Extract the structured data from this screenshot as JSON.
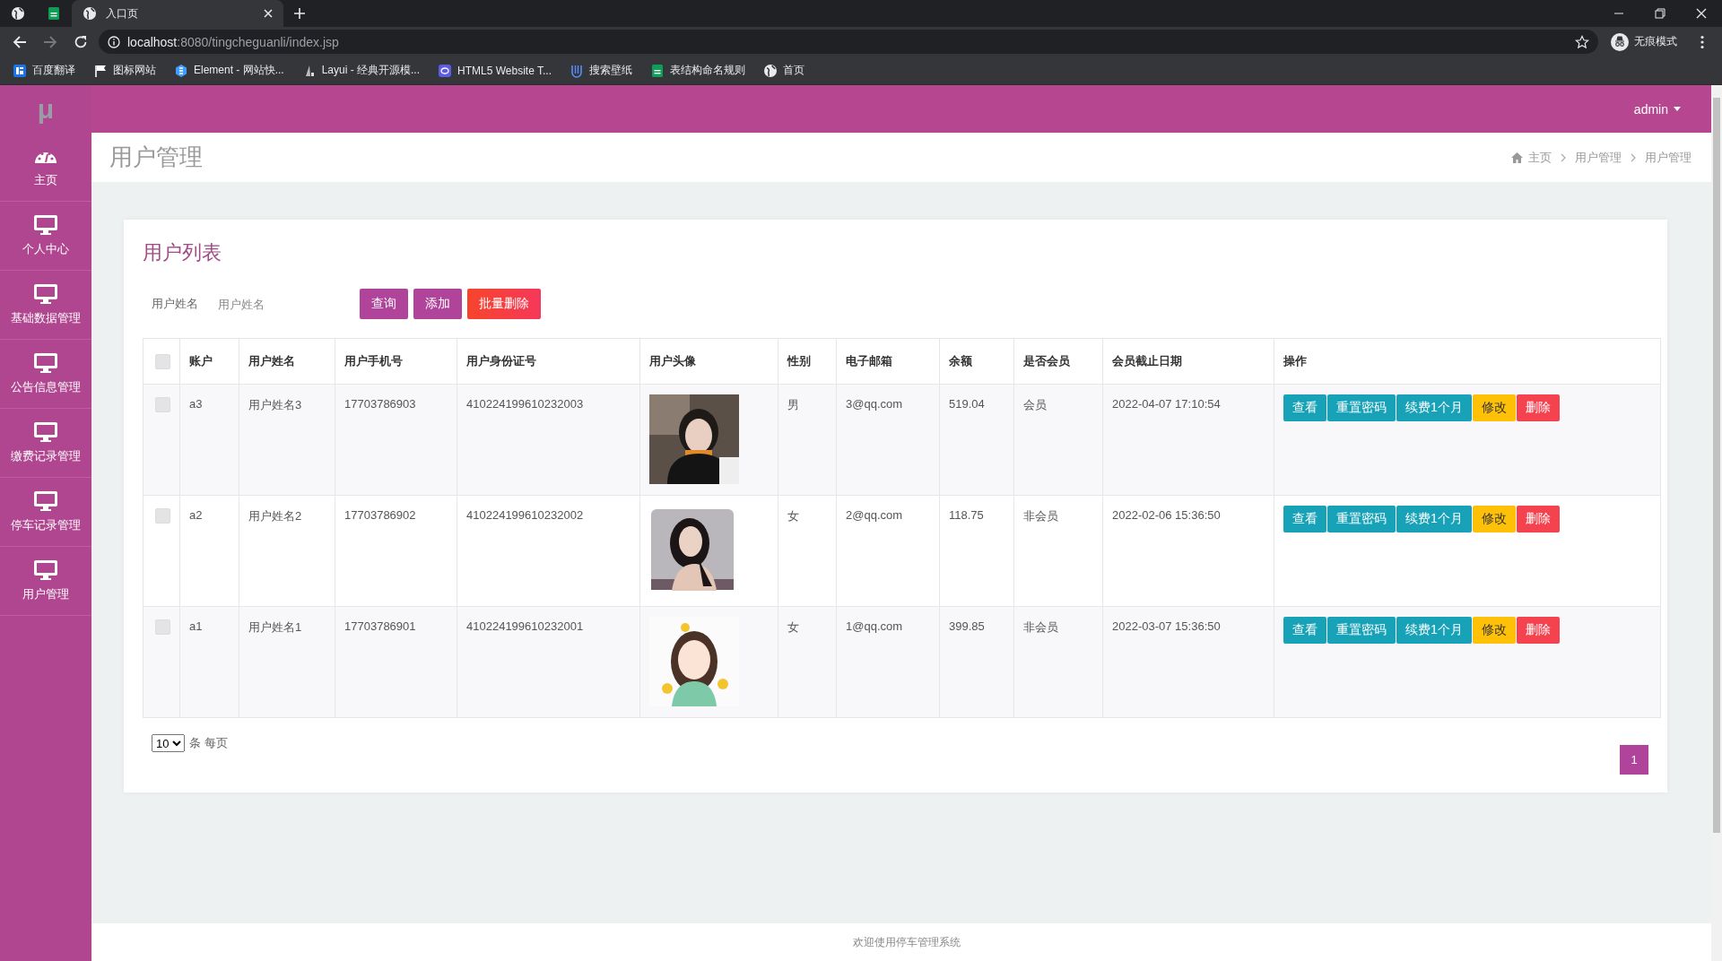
{
  "browser": {
    "tabs": [
      {
        "title": "入口页",
        "selected": true
      }
    ],
    "url": {
      "host": "localhost",
      "path": ":8080/tingcheguanli/index.jsp"
    },
    "profile": "无痕模式",
    "bookmarks": [
      {
        "kind": "translate",
        "label": "百度翻译"
      },
      {
        "kind": "flag",
        "label": "图标网站"
      },
      {
        "kind": "element",
        "label": "Element - 网站快..."
      },
      {
        "kind": "layui",
        "label": "Layui - 经典开源模..."
      },
      {
        "kind": "html5",
        "label": "HTML5 Website T..."
      },
      {
        "kind": "wallpaper",
        "label": "搜索壁纸"
      },
      {
        "kind": "sheet",
        "label": "表结构命名规则"
      },
      {
        "kind": "globe",
        "label": "首页"
      }
    ]
  },
  "app": {
    "logo": "μ",
    "user": "admin",
    "sidebar": [
      {
        "kind": "dashboard",
        "label": "主页"
      },
      {
        "kind": "monitor",
        "label": "个人中心"
      },
      {
        "kind": "monitor",
        "label": "基础数据管理"
      },
      {
        "kind": "monitor",
        "label": "公告信息管理"
      },
      {
        "kind": "monitor",
        "label": "缴费记录管理"
      },
      {
        "kind": "monitor",
        "label": "停车记录管理"
      },
      {
        "kind": "monitor",
        "label": "用户管理"
      }
    ],
    "page_title": "用户管理",
    "breadcrumb": [
      "主页",
      "用户管理",
      "用户管理"
    ],
    "card_title": "用户列表",
    "search": {
      "label": "用户姓名",
      "placeholder": "用户姓名"
    },
    "toolbar_buttons": [
      {
        "label": "查询",
        "kind": "primary"
      },
      {
        "label": "添加",
        "kind": "primary"
      },
      {
        "label": "批量删除",
        "kind": "danger"
      }
    ],
    "table": {
      "select_all": {
        "checked": false
      },
      "columns": [
        "账户",
        "用户姓名",
        "用户手机号",
        "用户身份证号",
        "用户头像",
        "性别",
        "电子邮箱",
        "余额",
        "是否会员",
        "会员截止日期",
        "操作"
      ],
      "rows": [
        {
          "checked": false,
          "account": "a3",
          "name": "用户姓名3",
          "phone": "17703786903",
          "id_number": "410224199610232003",
          "gender": "男",
          "email": "3@qq.com",
          "balance": "519.04",
          "member": "会员",
          "member_until": "2022-04-07 17:10:54",
          "actions": [
            {
              "label": "查看",
              "kind": "info"
            },
            {
              "label": "重置密码",
              "kind": "info"
            },
            {
              "label": "续费1个月",
              "kind": "info"
            },
            {
              "label": "修改",
              "kind": "warning"
            },
            {
              "label": "删除",
              "kind": "danger"
            }
          ]
        },
        {
          "checked": false,
          "account": "a2",
          "name": "用户姓名2",
          "phone": "17703786902",
          "id_number": "410224199610232002",
          "gender": "女",
          "email": "2@qq.com",
          "balance": "118.75",
          "member": "非会员",
          "member_until": "2022-02-06 15:36:50",
          "actions": [
            {
              "label": "查看",
              "kind": "info"
            },
            {
              "label": "重置密码",
              "kind": "info"
            },
            {
              "label": "续费1个月",
              "kind": "info"
            },
            {
              "label": "修改",
              "kind": "warning"
            },
            {
              "label": "删除",
              "kind": "danger"
            }
          ]
        },
        {
          "checked": false,
          "account": "a1",
          "name": "用户姓名1",
          "phone": "17703786901",
          "id_number": "410224199610232001",
          "gender": "女",
          "email": "1@qq.com",
          "balance": "399.85",
          "member": "非会员",
          "member_until": "2022-03-07 15:36:50",
          "actions": [
            {
              "label": "查看",
              "kind": "info"
            },
            {
              "label": "重置密码",
              "kind": "info"
            },
            {
              "label": "续费1个月",
              "kind": "info"
            },
            {
              "label": "修改",
              "kind": "warning"
            },
            {
              "label": "删除",
              "kind": "danger"
            }
          ]
        }
      ]
    },
    "pagination": {
      "page_size": "10",
      "page_size_unit": "条 每页",
      "pages": [
        {
          "label": "1",
          "selected": true
        }
      ]
    },
    "footer": "欢迎使用停车管理系统"
  }
}
